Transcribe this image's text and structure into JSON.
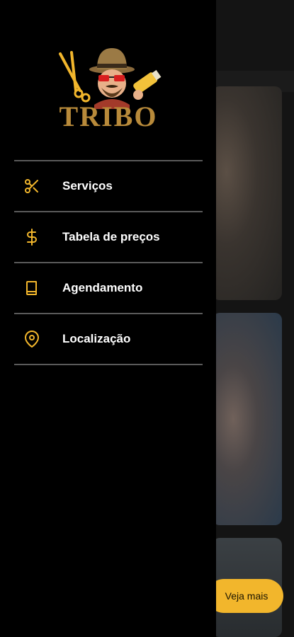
{
  "app": {
    "brand": "TRIBO"
  },
  "colors": {
    "accent": "#F2B62C",
    "drawer_bg": "#000000",
    "divider": "#5A5A5A",
    "text": "#FFFFFF"
  },
  "drawer": {
    "items": [
      {
        "label": "Serviços",
        "icon": "scissors-icon"
      },
      {
        "label": "Tabela de preços",
        "icon": "dollar-icon"
      },
      {
        "label": "Agendamento",
        "icon": "book-icon"
      },
      {
        "label": "Localização",
        "icon": "map-pin-icon"
      }
    ]
  },
  "background": {
    "cta_label": "Veja mais"
  }
}
